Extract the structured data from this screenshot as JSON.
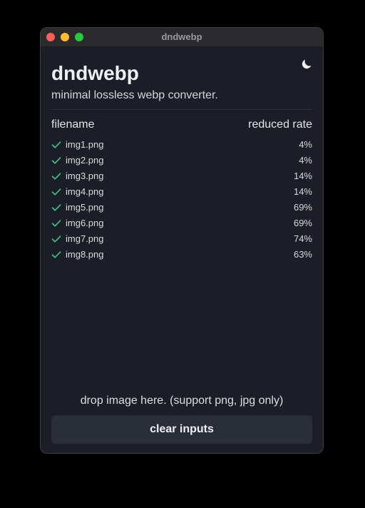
{
  "window": {
    "title": "dndwebp",
    "traffic_lights": {
      "close_color": "#ff5f57",
      "minimize_color": "#febc2e",
      "zoom_color": "#28c840"
    }
  },
  "header": {
    "theme_toggle_icon": "moon-icon",
    "title": "dndwebp",
    "subtitle": "minimal lossless webp converter."
  },
  "table": {
    "headers": {
      "filename": "filename",
      "reduced_rate": "reduced rate"
    },
    "status_icon": "check-icon",
    "status_color": "#3fb37f",
    "rows": [
      {
        "filename": "img1.png",
        "rate": "4%"
      },
      {
        "filename": "img2.png",
        "rate": "4%"
      },
      {
        "filename": "img3.png",
        "rate": "14%"
      },
      {
        "filename": "img4.png",
        "rate": "14%"
      },
      {
        "filename": "img5.png",
        "rate": "69%"
      },
      {
        "filename": "img6.png",
        "rate": "69%"
      },
      {
        "filename": "img7.png",
        "rate": "74%"
      },
      {
        "filename": "img8.png",
        "rate": "63%"
      }
    ]
  },
  "footer": {
    "drop_hint": "drop image here. (support png, jpg only)",
    "clear_label": "clear inputs"
  },
  "colors": {
    "background": "#1b1e26",
    "button_background": "#2a2e38",
    "text": "#eef0f4"
  }
}
